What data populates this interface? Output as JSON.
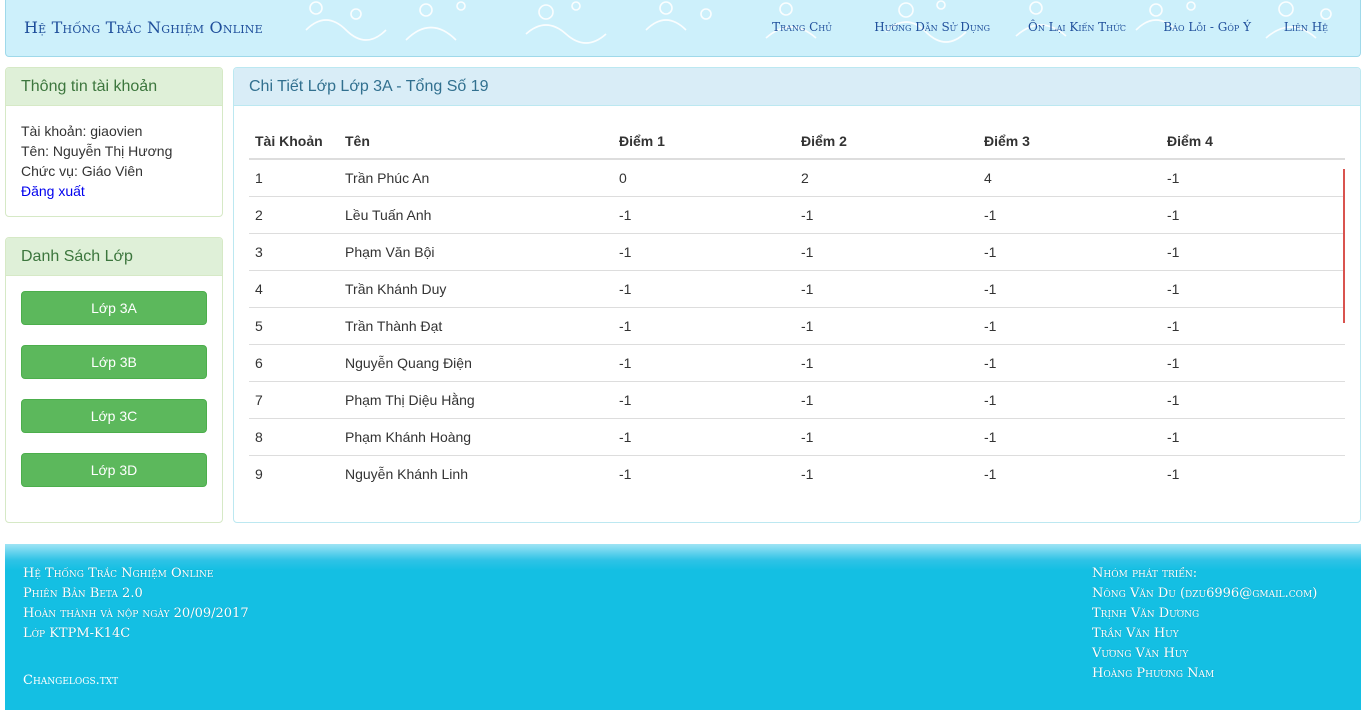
{
  "header": {
    "brand": "Hệ Thống Trắc Nghiệm Online",
    "nav": [
      "Trang Chủ",
      "Hướng Dẫn Sử Dụng",
      "Ôn Lại Kiến Thức",
      "Báo Lỗi - Góp Ý",
      "Liên Hệ"
    ]
  },
  "account": {
    "title": "Thông tin tài khoản",
    "username": "Tài khoản: giaovien",
    "name": "Tên: Nguyễn Thị Hương",
    "role": "Chức vụ: Giáo Viên",
    "logout": "Đăng xuất"
  },
  "classes": {
    "title": "Danh Sách Lớp",
    "items": [
      "Lớp 3A",
      "Lớp 3B",
      "Lớp 3C",
      "Lớp 3D"
    ]
  },
  "main": {
    "title": "Chi Tiết Lớp Lớp 3A - Tổng Số 19",
    "columns": [
      "Tài Khoản",
      "Tên",
      "Điểm 1",
      "Điểm 2",
      "Điểm 3",
      "Điểm 4"
    ],
    "rows": [
      [
        "1",
        "Trần Phúc An",
        "0",
        "2",
        "4",
        "-1"
      ],
      [
        "2",
        "Lều Tuấn Anh",
        "-1",
        "-1",
        "-1",
        "-1"
      ],
      [
        "3",
        "Phạm Văn Bội",
        "-1",
        "-1",
        "-1",
        "-1"
      ],
      [
        "4",
        "Trần Khánh Duy",
        "-1",
        "-1",
        "-1",
        "-1"
      ],
      [
        "5",
        "Trần Thành Đạt",
        "-1",
        "-1",
        "-1",
        "-1"
      ],
      [
        "6",
        "Nguyễn Quang Điện",
        "-1",
        "-1",
        "-1",
        "-1"
      ],
      [
        "7",
        "Phạm Thị Diệu Hằng",
        "-1",
        "-1",
        "-1",
        "-1"
      ],
      [
        "8",
        "Phạm Khánh Hoàng",
        "-1",
        "-1",
        "-1",
        "-1"
      ],
      [
        "9",
        "Nguyễn Khánh Linh",
        "-1",
        "-1",
        "-1",
        "-1"
      ]
    ]
  },
  "footer": {
    "left": [
      "Hệ Thống Trắc Nghiệm Online",
      "Phiên Bản Beta 2.0",
      "Hoàn thành và nộp ngày 20/09/2017",
      "Lớp KTPM-K14C"
    ],
    "changelog": "Changelogs.txt",
    "right": [
      "Nhóm phát triển:",
      "Nông Văn Du (dzu6996@gmail.com)",
      "Trịnh Văn Dương",
      "Trần Văn Huy",
      "Vương Văn Huy",
      "Hoàng Phương Nam"
    ]
  },
  "colors": {
    "header_bg": "#cdf0fb",
    "brand_text": "#1e4e9b",
    "green_button": "#5cb85c",
    "footer_bg": "#14bfe3"
  }
}
